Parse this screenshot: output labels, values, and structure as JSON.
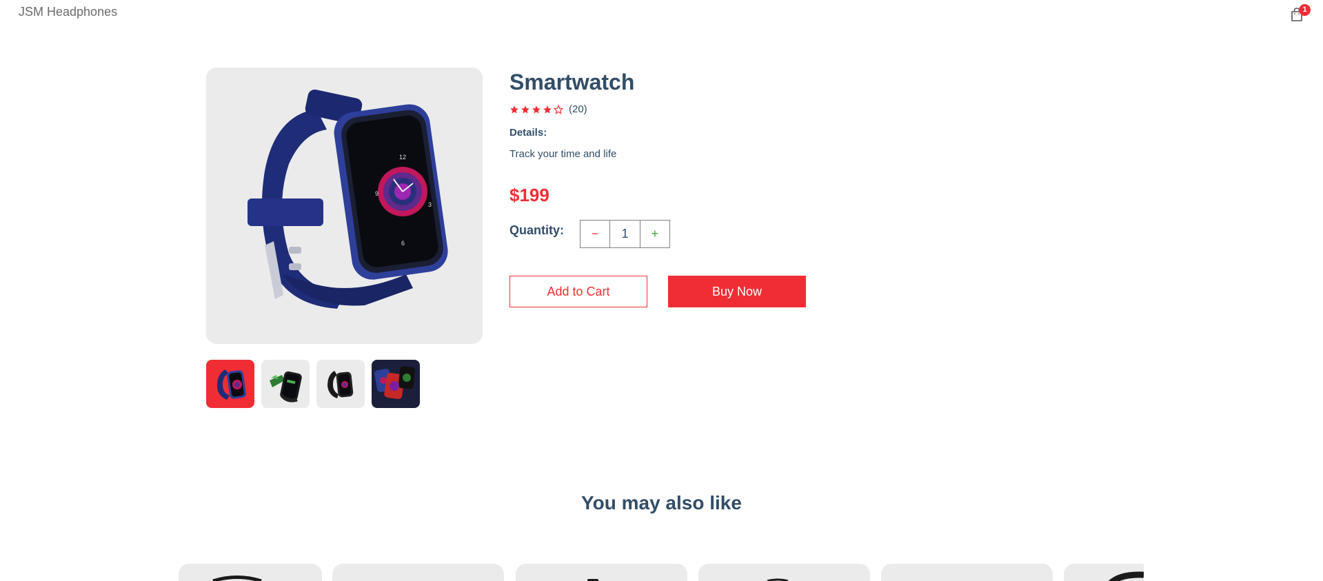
{
  "navbar": {
    "logo": "JSM Headphones",
    "cart_count": "1"
  },
  "product": {
    "name": "Smartwatch",
    "rating": 4,
    "rating_max": 5,
    "review_count": "(20)",
    "details_label": "Details:",
    "details": "Track your time and life",
    "price": "$199",
    "quantity_label": "Quantity:",
    "quantity": "1",
    "minus_symbol": "−",
    "plus_symbol": "+",
    "thumbnails": [
      {
        "name": "watch-blue-front",
        "selected": true
      },
      {
        "name": "watch-black-green-charging",
        "selected": false
      },
      {
        "name": "watch-black-side",
        "selected": false
      },
      {
        "name": "watch-multi-faces",
        "selected": false
      }
    ]
  },
  "actions": {
    "add_to_cart": "Add to Cart",
    "buy_now": "Buy Now"
  },
  "also_like": {
    "title": "You may also like"
  },
  "colors": {
    "accent": "#f02d34",
    "text_dark": "#324d67",
    "image_bg": "#ebebeb",
    "plus_green": "#31a831"
  }
}
